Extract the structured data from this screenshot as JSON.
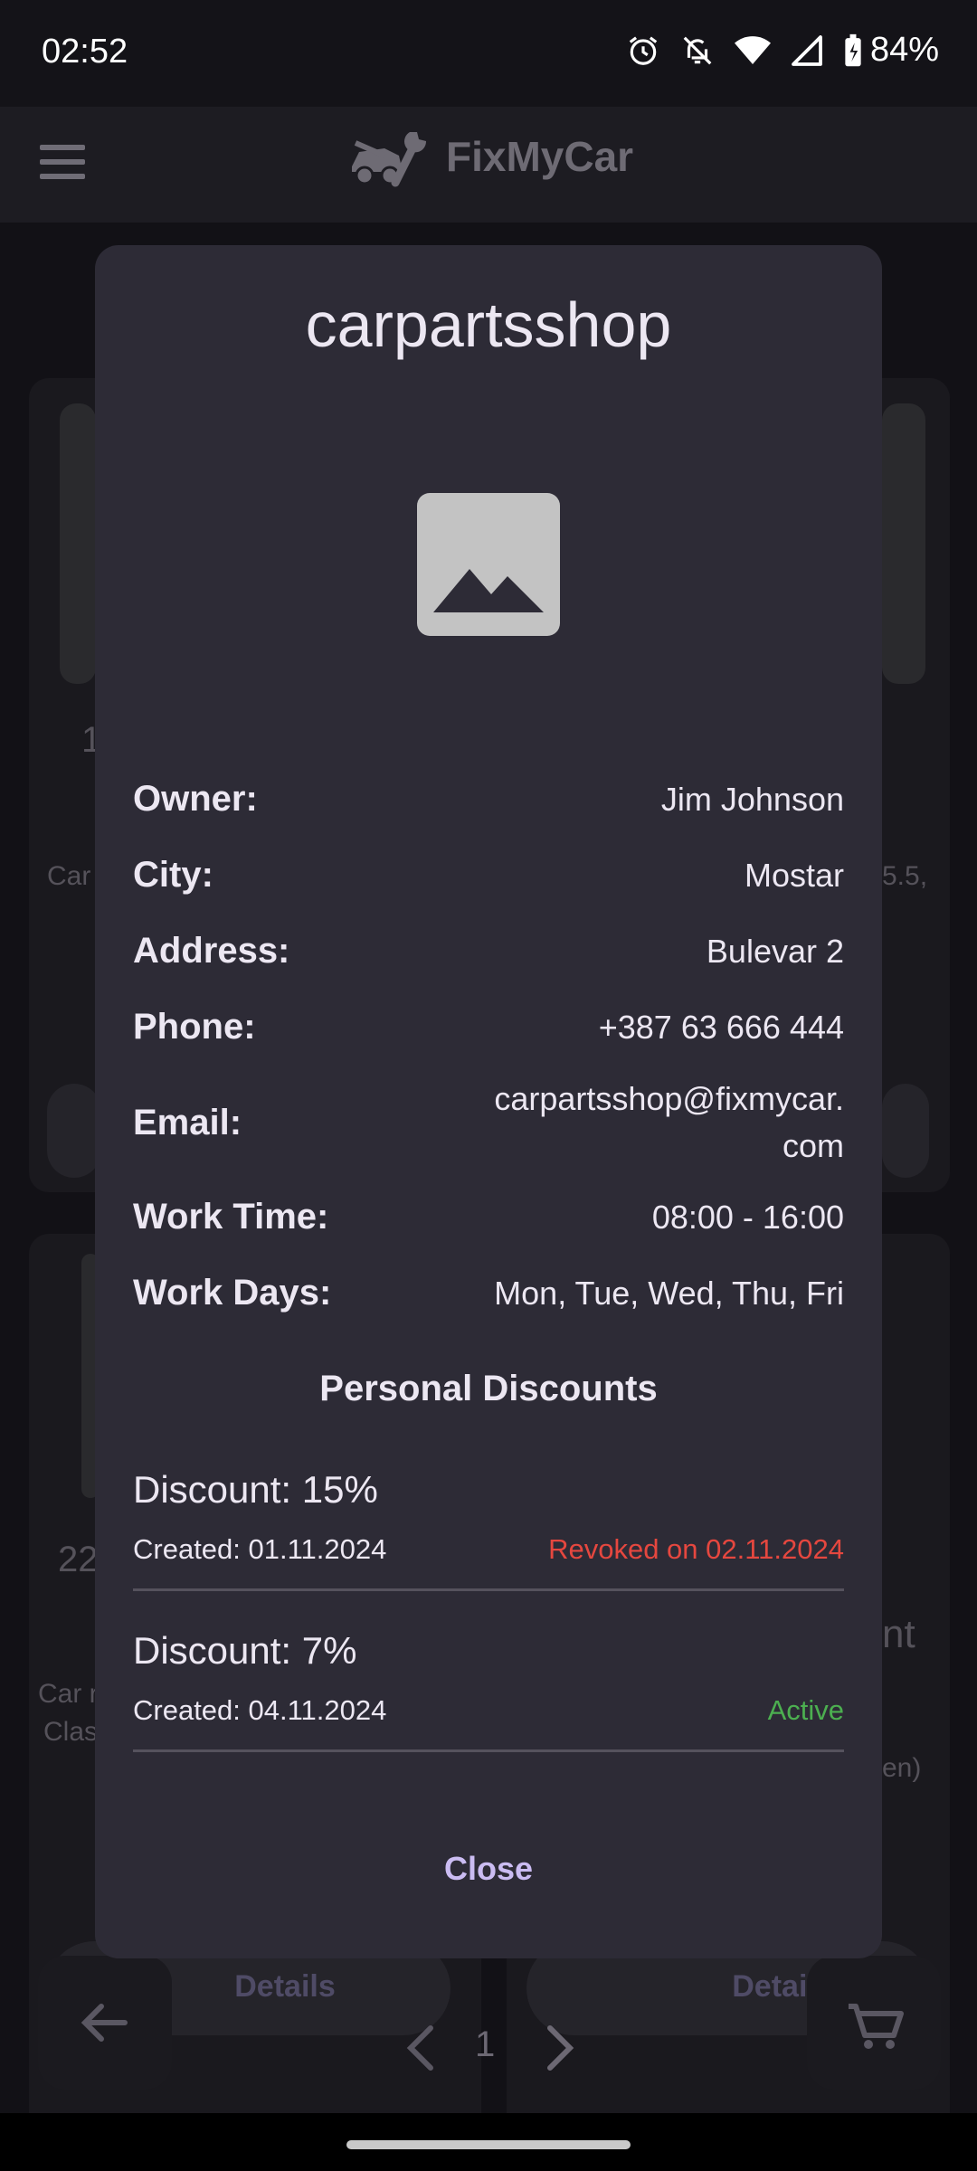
{
  "status_bar": {
    "time": "02:52",
    "battery": "84%"
  },
  "app": {
    "title": "FixMyCar"
  },
  "background": {
    "texts": [
      "1",
      "Car",
      "5.5,",
      "22",
      "Car r",
      "Clas",
      "nt",
      "en)"
    ],
    "detail_buttons": [
      "Details",
      "Details"
    ],
    "page_number": "1"
  },
  "dialog": {
    "title": "carpartsshop",
    "fields": [
      {
        "label": "Owner:",
        "value": "Jim Johnson"
      },
      {
        "label": "City:",
        "value": "Mostar"
      },
      {
        "label": "Address:",
        "value": "Bulevar 2"
      },
      {
        "label": "Phone:",
        "value": "+387 63 666 444"
      },
      {
        "label": "Email:",
        "value": "carpartsshop@fixmycar.com"
      },
      {
        "label": "Work Time:",
        "value": "08:00 - 16:00"
      },
      {
        "label": "Work Days:",
        "value": "Mon, Tue, Wed, Thu, Fri"
      }
    ],
    "discounts_title": "Personal Discounts",
    "discounts": [
      {
        "amount": "Discount: 15%",
        "created": "Created: 01.11.2024",
        "status": "Revoked on 02.11.2024",
        "status_type": "revoked"
      },
      {
        "amount": "Discount: 7%",
        "created": "Created: 04.11.2024",
        "status": "Active",
        "status_type": "active"
      }
    ],
    "close_label": "Close"
  },
  "colors": {
    "dialog_bg": "#2d2b36",
    "accent": "#cbbcf2",
    "revoked": "#e5473f",
    "active": "#4caf50"
  }
}
